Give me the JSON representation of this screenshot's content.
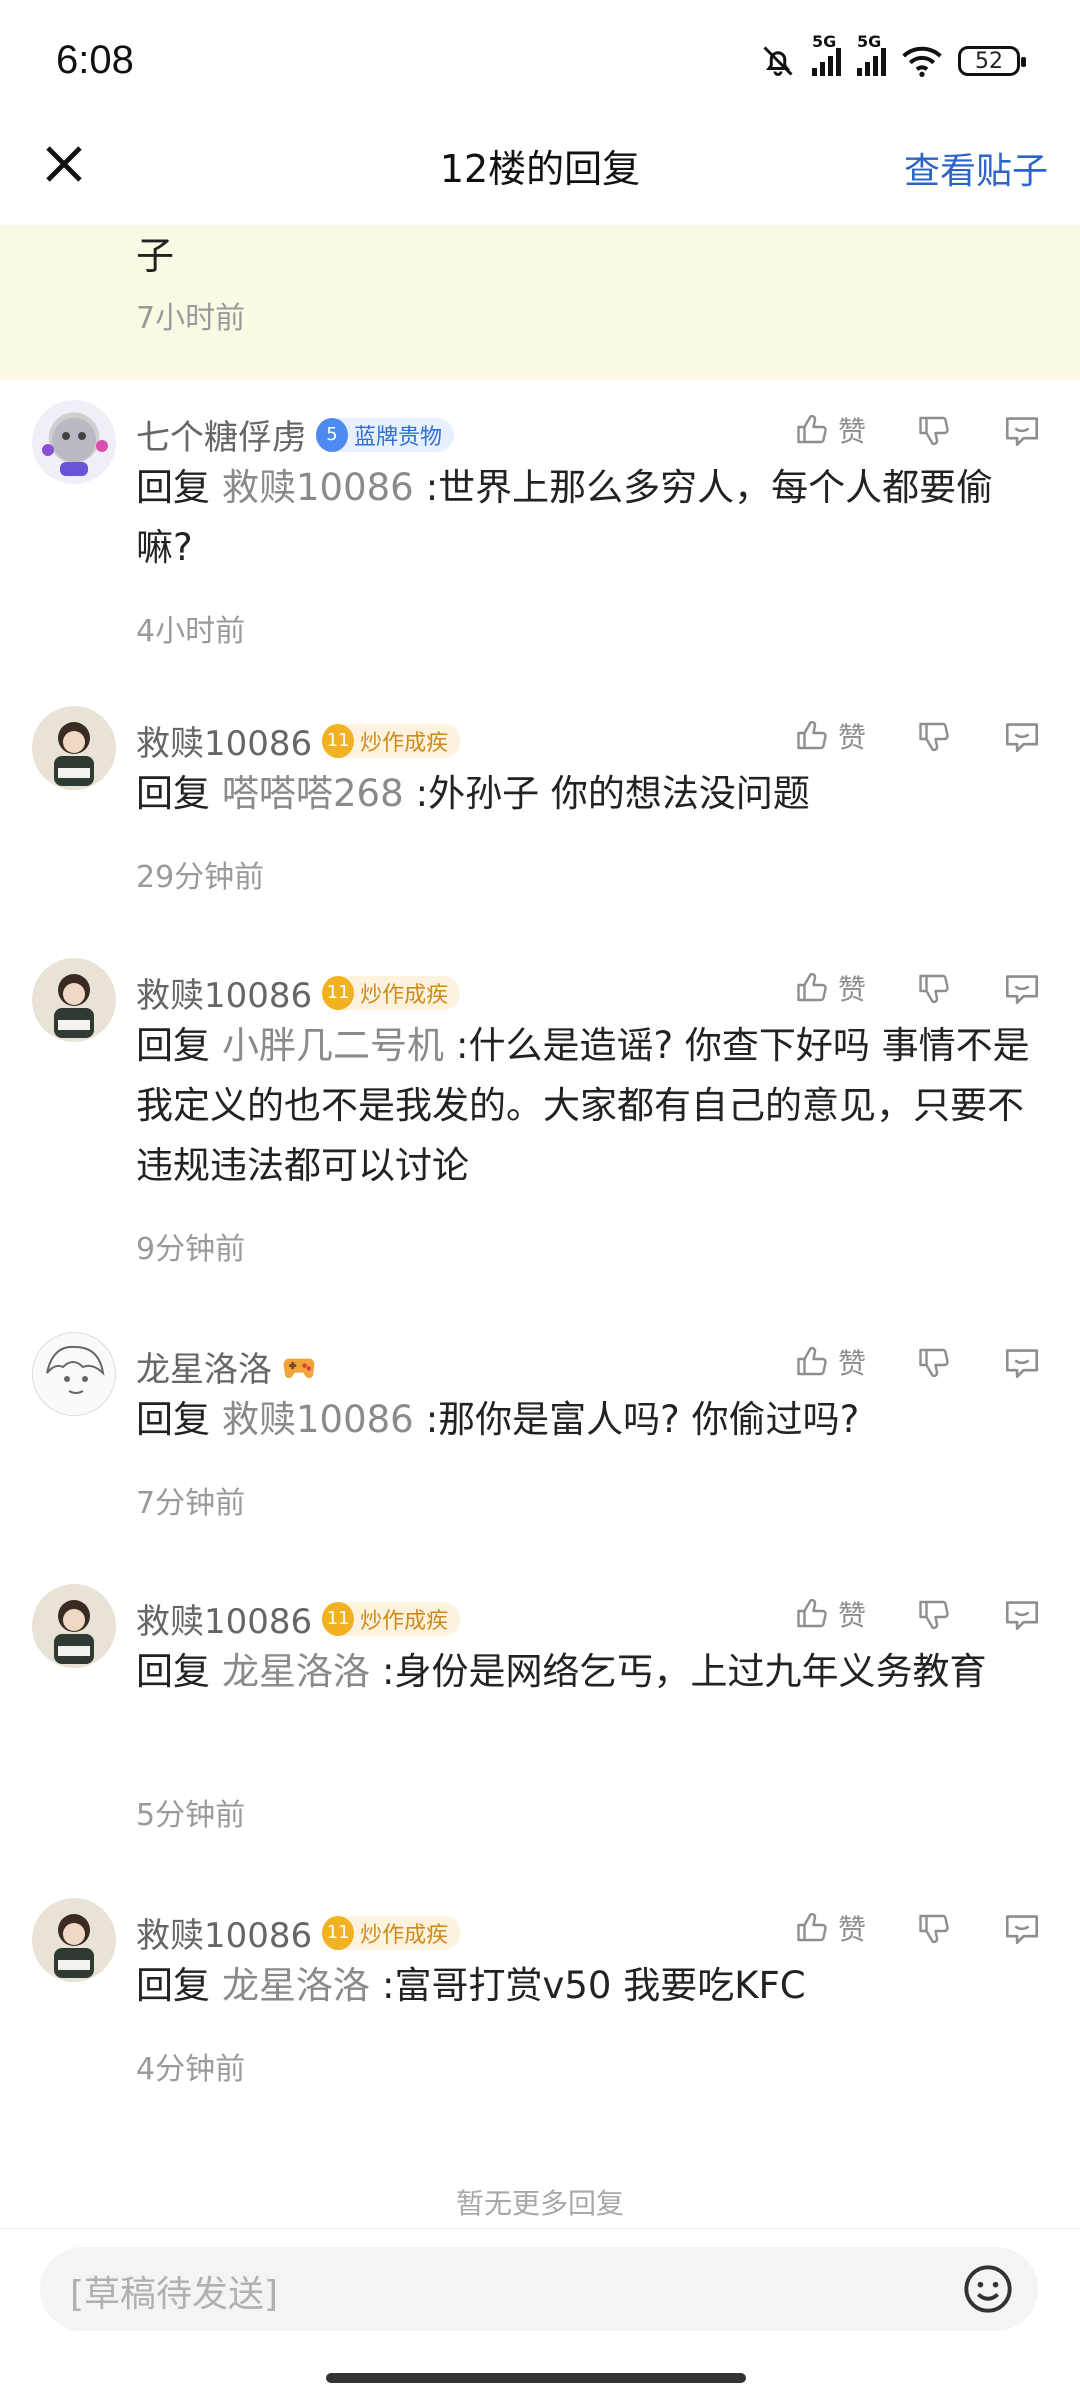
{
  "status": {
    "time": "6:08",
    "battery": "52",
    "net1": "5G",
    "net2": "5G"
  },
  "header": {
    "title": "12楼的回复",
    "view_post": "查看贴子"
  },
  "highlight": {
    "text": "子",
    "time": "7小时前"
  },
  "comments": [
    {
      "user": "七个糖俘虏",
      "level": "5",
      "badge": "蓝牌贵物",
      "badge_type": "blue",
      "reply_word": "回复",
      "target": "救赎10086",
      "content": ":世界上那么多穷人，每个人都要偷嘛?",
      "time": "4小时前",
      "like": "赞"
    },
    {
      "user": "救赎10086",
      "level": "11",
      "badge": "炒作成疾",
      "badge_type": "gold",
      "reply_word": "回复",
      "target": "嗒嗒嗒268",
      "content": ":外孙子 你的想法没问题",
      "time": "29分钟前",
      "like": "赞"
    },
    {
      "user": "救赎10086",
      "level": "11",
      "badge": "炒作成疾",
      "badge_type": "gold",
      "reply_word": "回复",
      "target": "小胖几二号机",
      "content": ":什么是造谣? 你查下好吗 事情不是我定义的也不是我发的。大家都有自己的意见，只要不违规违法都可以讨论",
      "time": "9分钟前",
      "like": "赞"
    },
    {
      "user": "龙星洛洛",
      "level": "",
      "badge": "",
      "badge_type": "none",
      "reply_word": "回复",
      "target": "救赎10086",
      "content": ":那你是富人吗? 你偷过吗?",
      "time": "7分钟前",
      "like": "赞"
    },
    {
      "user": "救赎10086",
      "level": "11",
      "badge": "炒作成疾",
      "badge_type": "gold",
      "reply_word": "回复",
      "target": "龙星洛洛",
      "content": ":身份是网络乞丐，上过九年义务教育",
      "time": "5分钟前",
      "like": "赞"
    },
    {
      "user": "救赎10086",
      "level": "11",
      "badge": "炒作成疾",
      "badge_type": "gold",
      "reply_word": "回复",
      "target": "龙星洛洛",
      "content": ":富哥打赏v50 我要吃KFC",
      "time": "4分钟前",
      "like": "赞"
    }
  ],
  "footer": {
    "no_more": "暂无更多回复",
    "input_placeholder": "[草稿待发送]"
  }
}
